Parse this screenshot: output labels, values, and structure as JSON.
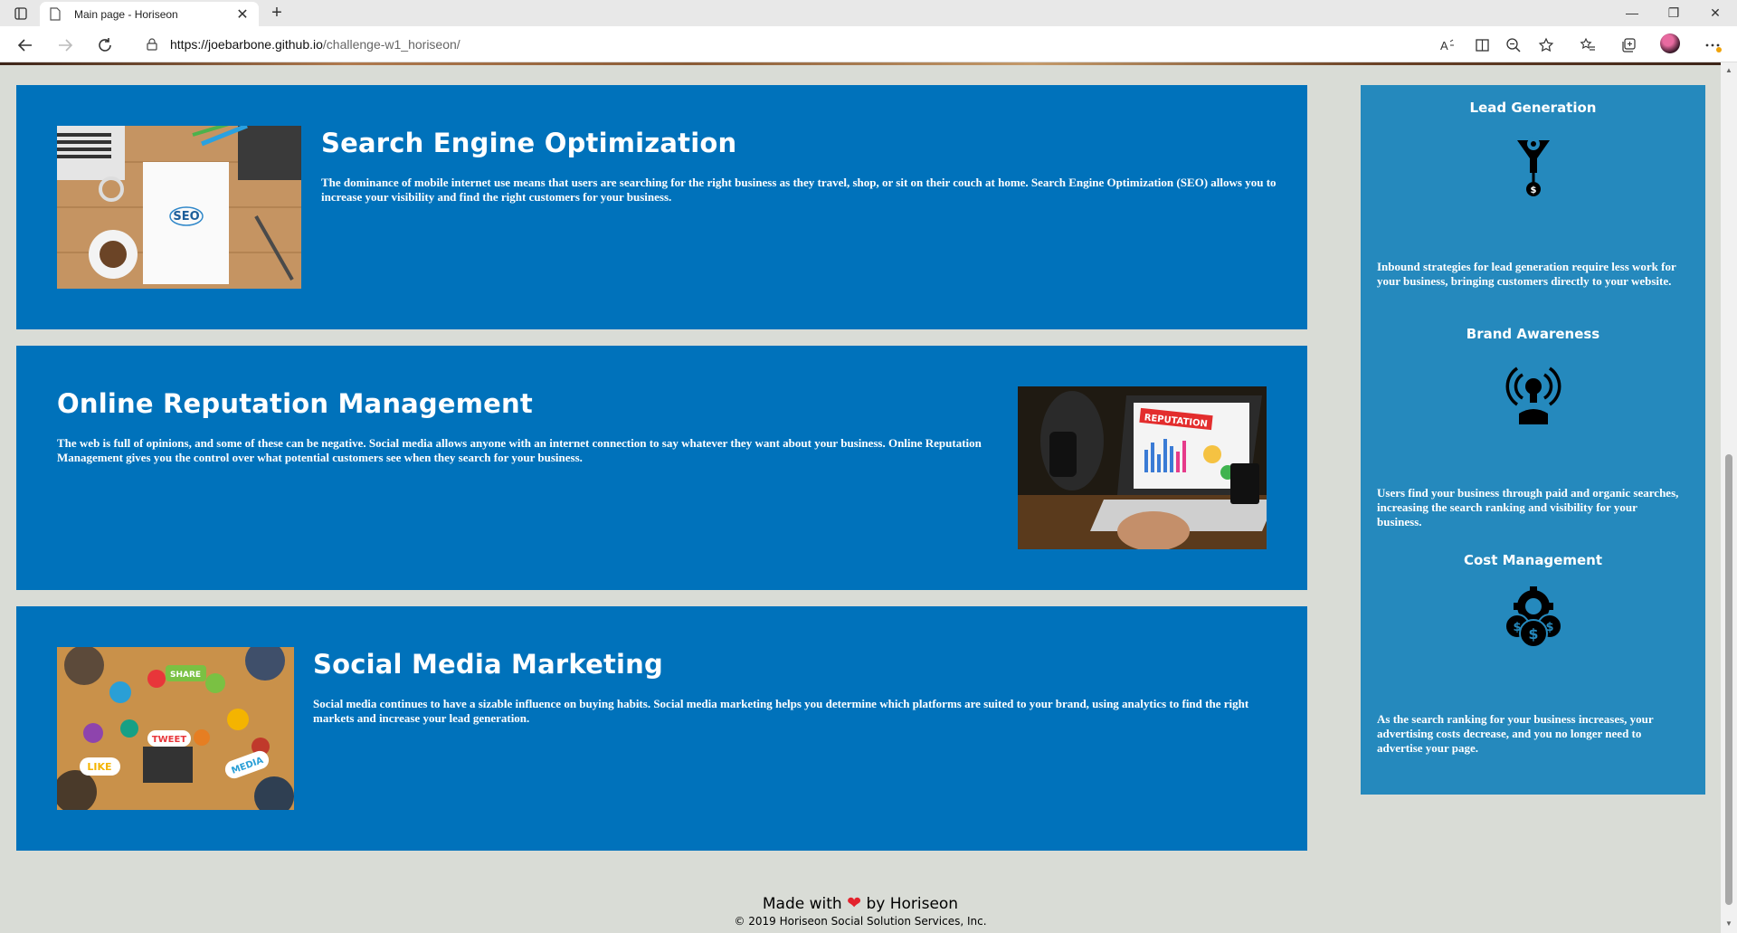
{
  "browser": {
    "tab_title": "Main page - Horiseon",
    "url_host": "https://joebarbone.github.io",
    "url_path": "/challenge-w1_horiseon/"
  },
  "cards": [
    {
      "title": "Search Engine Optimization",
      "text": "The dominance of mobile internet use means that users are searching for the right business as they travel, shop, or sit on their couch at home. Search Engine Optimization (SEO) allows you to increase your visibility and find the right customers for your business.",
      "image_label": "SEO"
    },
    {
      "title": "Online Reputation Management",
      "text": "The web is full of opinions, and some of these can be negative. Social media allows anyone with an internet connection to say whatever they want about your business. Online Reputation Management gives you the control over what potential customers see when they search for your business.",
      "image_label": "REPUTATION"
    },
    {
      "title": "Social Media Marketing",
      "text": "Social media continues to have a sizable influence on buying habits. Social media marketing helps you determine which platforms are suited to your brand, using analytics to find the right markets and increase your lead generation.",
      "image_labels": [
        "SHARE",
        "TWEET",
        "LIKE",
        "MEDIA"
      ]
    }
  ],
  "benefits": [
    {
      "title": "Lead Generation",
      "icon": "lead-generation-icon",
      "text": "Inbound strategies for lead generation require less work for your business, bringing customers directly to your website."
    },
    {
      "title": "Brand Awareness",
      "icon": "brand-awareness-icon",
      "text": "Users find your business through paid and organic searches, increasing the search ranking and visibility for your business."
    },
    {
      "title": "Cost Management",
      "icon": "cost-management-icon",
      "text": "As the search ranking for your business increases, your advertising costs decrease, and you no longer need to advertise your page."
    }
  ],
  "footer": {
    "made_with": "Made with",
    "heart": "❤",
    "by": "by Horiseon",
    "copyright": "© 2019 Horiseon Social Solution Services, Inc."
  },
  "colors": {
    "card_blue": "#0072bb",
    "benefit_blue": "#2589bd",
    "page_bg": "#d9dcd6",
    "heart_red": "#e3222c"
  }
}
